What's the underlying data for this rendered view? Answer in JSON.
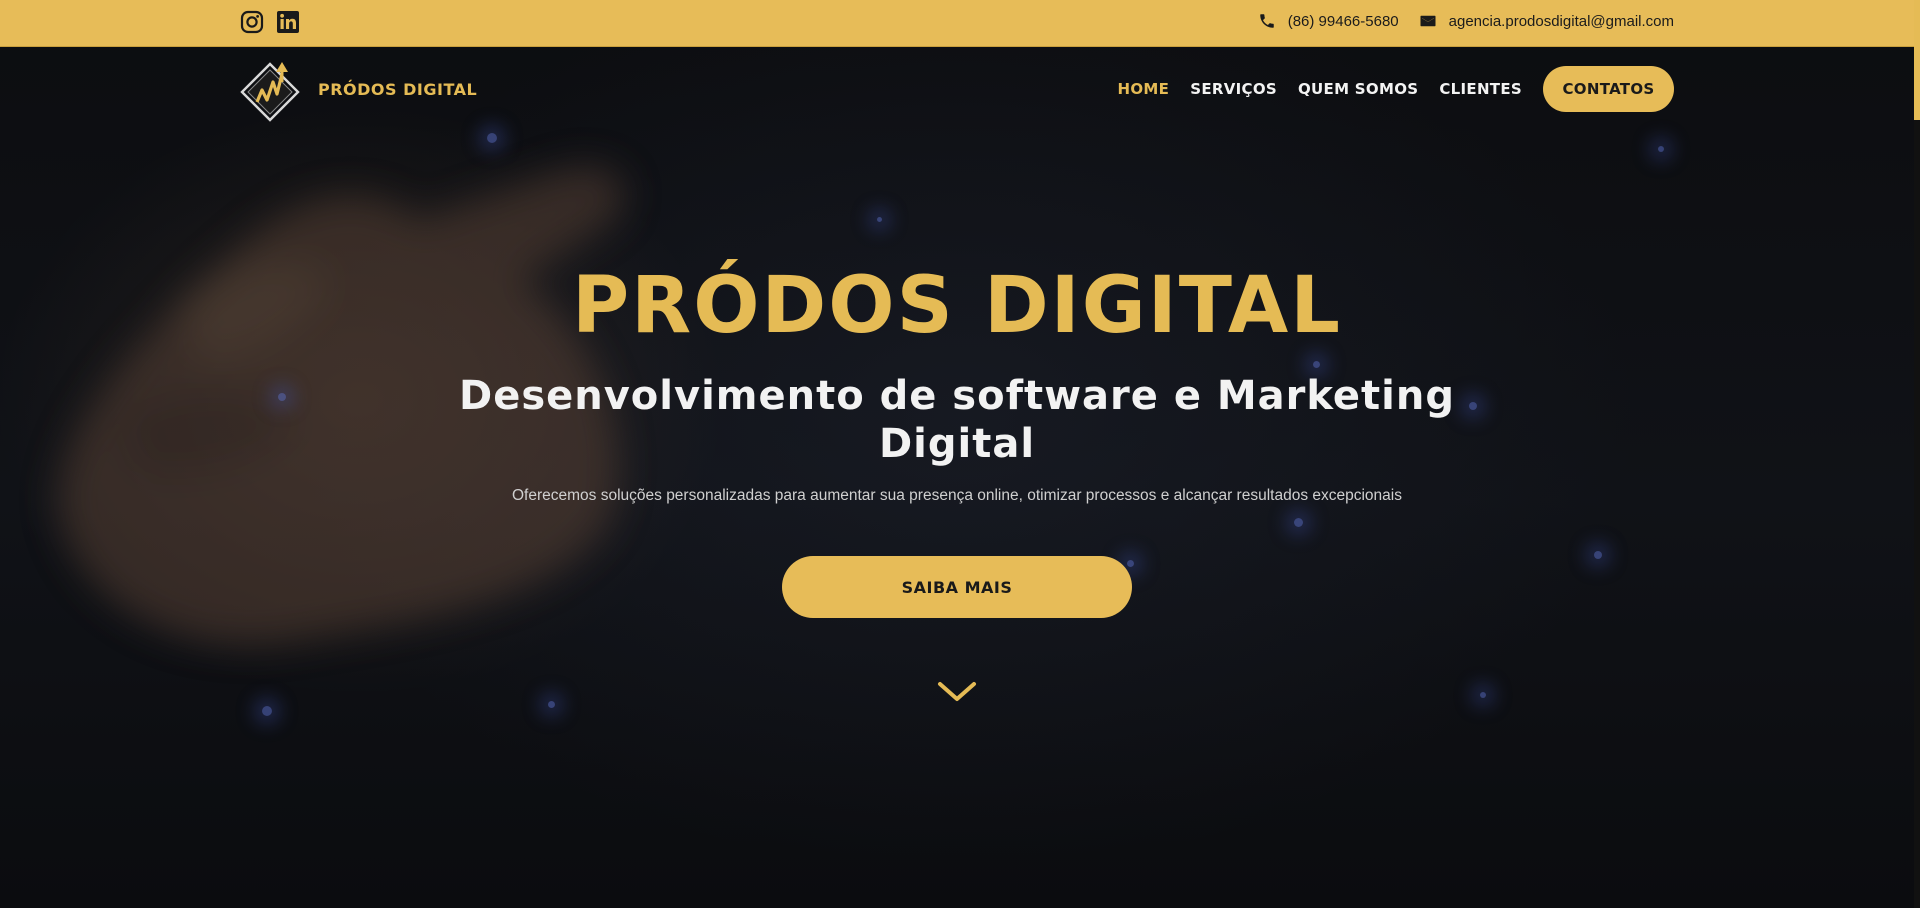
{
  "colors": {
    "accent": "#e7bc58",
    "accent_text": "#e5bb55",
    "dark_bg": "#0e0f12",
    "light_text": "#f2f2f2"
  },
  "topbar": {
    "social": [
      {
        "icon": "instagram-icon"
      },
      {
        "icon": "linkedin-icon"
      }
    ],
    "phone": {
      "icon": "phone-icon",
      "text": "(86) 99466-5680"
    },
    "email": {
      "icon": "mail-icon",
      "text": "agencia.prodosdigital@gmail.com"
    }
  },
  "nav": {
    "brand": {
      "logo_icon": "prodos-logo-icon",
      "name": "PRÓDOS DIGITAL"
    },
    "items": [
      {
        "label": "HOME",
        "active": true
      },
      {
        "label": "SERVIÇOS",
        "active": false
      },
      {
        "label": "QUEM SOMOS",
        "active": false
      },
      {
        "label": "CLIENTES",
        "active": false
      }
    ],
    "cta": "CONTATOS"
  },
  "hero": {
    "title": "PRÓDOS DIGITAL",
    "subtitle": "Desenvolvimento de software e Marketing Digital",
    "text": "Oferecemos soluções personalizadas para aumentar sua presença online, otimizar processos e alcançar resultados excepcionais",
    "cta": "SAIBA MAIS",
    "scroll_icon": "chevron-down-icon"
  }
}
